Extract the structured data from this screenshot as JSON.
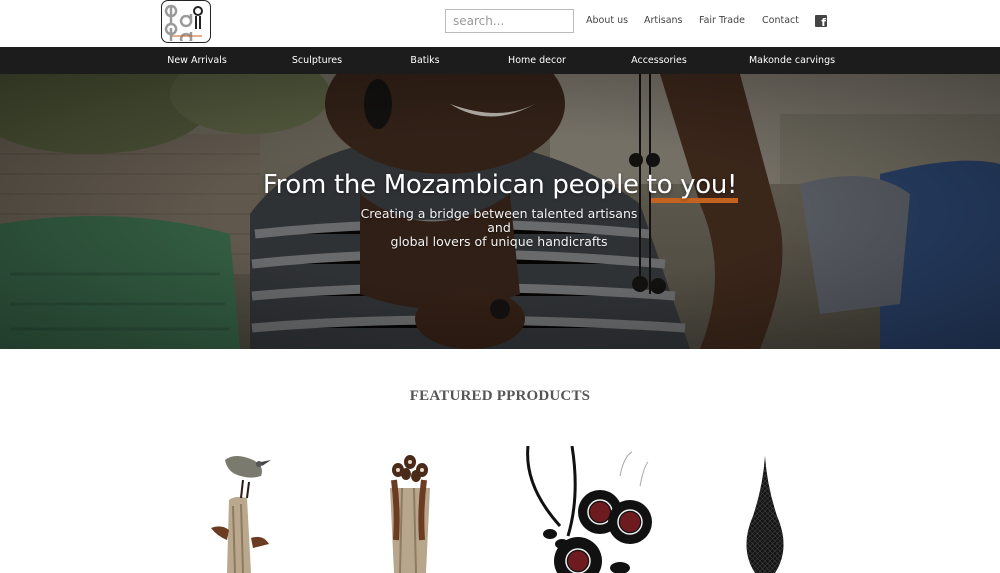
{
  "header": {
    "logo_text": "baart",
    "search": {
      "placeholder": "search..."
    },
    "nav": [
      "About us",
      "Artisans",
      "Fair Trade",
      "Contact"
    ],
    "social_icon": "facebook-icon"
  },
  "categories": [
    "New Arrivals",
    "Sculptures",
    "Batiks",
    "Home decor",
    "Accessories",
    "Makonde carvings"
  ],
  "hero": {
    "title": "From the Mozambican people to you!",
    "subtitle_line1": "Creating a bridge between talented artisans and",
    "subtitle_line2": "global lovers of unique handicrafts"
  },
  "featured": {
    "title": "FEATURED PPRODUCTS"
  },
  "colors": {
    "category_bar": "#1c1c1c",
    "accent": "#c4621f",
    "text": "#555555"
  }
}
